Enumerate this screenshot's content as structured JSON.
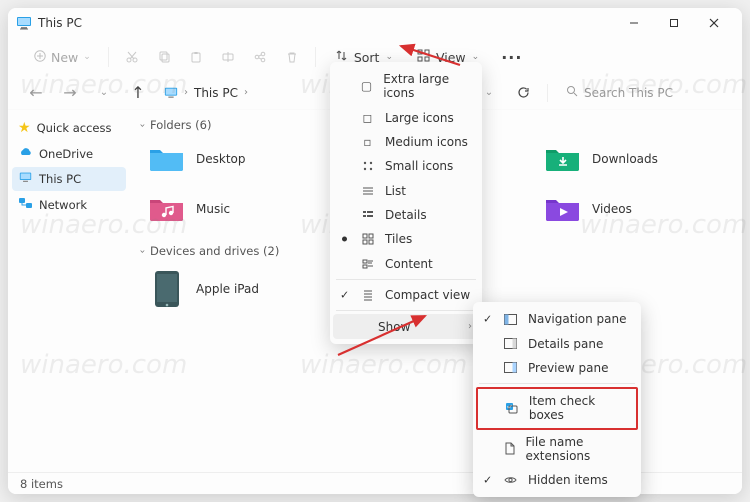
{
  "window": {
    "title": "This PC"
  },
  "toolbar": {
    "new_label": "New",
    "sort_label": "Sort",
    "view_label": "View"
  },
  "breadcrumb": {
    "location": "This PC"
  },
  "search": {
    "placeholder": "Search This PC"
  },
  "sidebar": {
    "items": [
      {
        "label": "Quick access"
      },
      {
        "label": "OneDrive"
      },
      {
        "label": "This PC"
      },
      {
        "label": "Network"
      }
    ]
  },
  "content": {
    "folders_header": "Folders (6)",
    "folders": [
      {
        "label": "Desktop",
        "color": "#2aa0e6"
      },
      {
        "label": "Downloads",
        "color": "#17b07a"
      },
      {
        "label": "Music",
        "color": "#e05a8c"
      },
      {
        "label": "Videos",
        "color": "#8a49e0"
      }
    ],
    "drives_header": "Devices and drives (2)",
    "drives": [
      {
        "label": "Apple iPad"
      }
    ]
  },
  "status": {
    "item_count": "8 items"
  },
  "view_menu": {
    "items": [
      {
        "label": "Extra large icons"
      },
      {
        "label": "Large icons"
      },
      {
        "label": "Medium icons"
      },
      {
        "label": "Small icons"
      },
      {
        "label": "List"
      },
      {
        "label": "Details"
      },
      {
        "label": "Tiles",
        "selected": true
      },
      {
        "label": "Content"
      },
      {
        "label": "Compact view",
        "checked": true
      },
      {
        "label": "Show",
        "submenu": true
      }
    ]
  },
  "show_submenu": {
    "items": [
      {
        "label": "Navigation pane",
        "checked": true
      },
      {
        "label": "Details pane"
      },
      {
        "label": "Preview pane"
      },
      {
        "label": "Item check boxes",
        "highlighted": true
      },
      {
        "label": "File name extensions"
      },
      {
        "label": "Hidden items",
        "checked": true
      }
    ]
  },
  "watermark": "winaero.com"
}
